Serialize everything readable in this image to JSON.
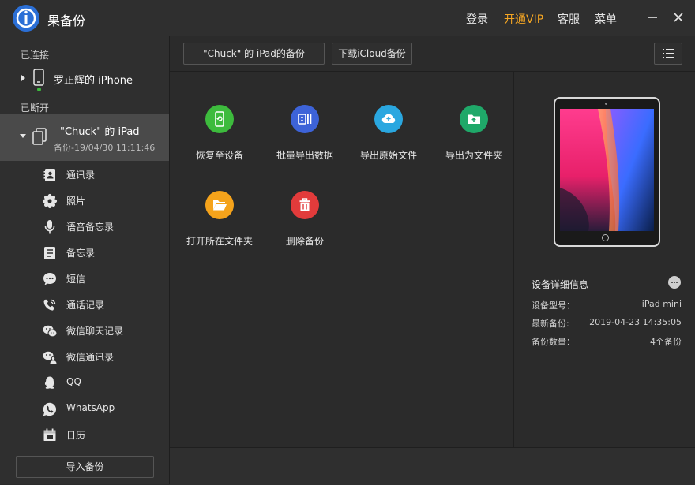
{
  "app": {
    "title": "果备份"
  },
  "top_menu": {
    "login": "登录",
    "vip": "开通VIP",
    "service": "客服",
    "menu": "菜单"
  },
  "colors": {
    "accent_vip": "#f5a623",
    "restore": "#3dbb3d",
    "batch_export": "#3d63d8",
    "export_raw": "#2aa7e0",
    "export_folder": "#1fa869",
    "open_folder": "#f5a31b",
    "delete": "#e23b3b",
    "selected_row": "#4a4a4a"
  },
  "sidebar": {
    "connected_label": "已连接",
    "connected_device": {
      "name": "罗正辉的 iPhone",
      "icon": "phone-icon"
    },
    "disconnected_label": "已断开",
    "disconnected_device": {
      "name": "\"Chuck\" 的 iPad",
      "backup_time": "备份-19/04/30 11:11:46",
      "icon": "ipad-copy-icon"
    },
    "items": [
      {
        "label": "通讯录",
        "icon": "contacts-icon"
      },
      {
        "label": "照片",
        "icon": "photos-icon"
      },
      {
        "label": "语音备忘录",
        "icon": "microphone-icon"
      },
      {
        "label": "备忘录",
        "icon": "notes-icon"
      },
      {
        "label": "短信",
        "icon": "message-icon"
      },
      {
        "label": "通话记录",
        "icon": "phone-call-icon"
      },
      {
        "label": "微信聊天记录",
        "icon": "wechat-icon"
      },
      {
        "label": "微信通讯录",
        "icon": "wechat-contacts-icon"
      },
      {
        "label": "QQ",
        "icon": "qq-icon"
      },
      {
        "label": "WhatsApp",
        "icon": "whatsapp-icon"
      },
      {
        "label": "日历",
        "icon": "calendar-icon"
      }
    ],
    "import_button": "导入备份"
  },
  "toolbar": {
    "backup_name": "\"Chuck\" 的 iPad的备份",
    "icloud_button": "下载iCloud备份",
    "list_icon": "list-icon"
  },
  "actions": [
    {
      "label": "恢复至设备",
      "icon": "restore-device-icon"
    },
    {
      "label": "批量导出数据",
      "icon": "batch-export-icon"
    },
    {
      "label": "导出原始文件",
      "icon": "upload-icon"
    },
    {
      "label": "导出为文件夹",
      "icon": "folder-upload-icon"
    },
    {
      "label": "打开所在文件夹",
      "icon": "open-folder-icon"
    },
    {
      "label": "删除备份",
      "icon": "trash-icon"
    }
  ],
  "detail": {
    "title": "设备详细信息",
    "model_label": "设备型号：",
    "model_value": "iPad mini",
    "latest_label": "最新备份:",
    "latest_value": "2019-04-23 14:35:05",
    "count_label": "备份数量：",
    "count_value": "4个备份"
  }
}
